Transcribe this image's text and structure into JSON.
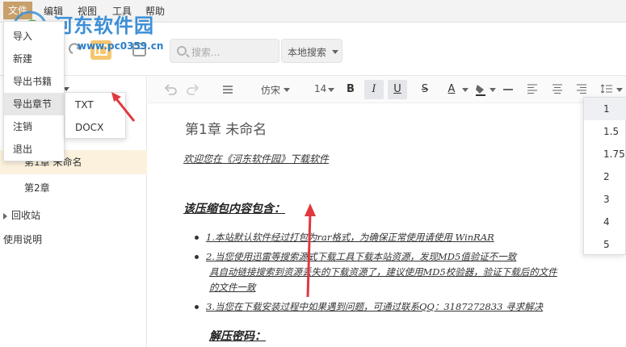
{
  "menubar": {
    "items": [
      {
        "label": "文件"
      },
      {
        "label": "编辑"
      },
      {
        "label": "视图"
      },
      {
        "label": "工具"
      },
      {
        "label": "帮助"
      }
    ]
  },
  "watermark": {
    "title": "河东软件园",
    "url": "www.pc0359.cn"
  },
  "toolbar": {
    "search_placeholder": "搜索...",
    "search_scope": "本地搜索"
  },
  "file_menu": {
    "items": [
      {
        "label": "导入"
      },
      {
        "label": "新建"
      },
      {
        "label": "导出书籍"
      },
      {
        "label": "导出章节"
      },
      {
        "label": "注销"
      },
      {
        "label": "退出"
      }
    ],
    "submenu": [
      {
        "label": "TXT"
      },
      {
        "label": "DOCX"
      }
    ]
  },
  "sidebar": {
    "chapters": [
      {
        "label": "第1章 未命名"
      },
      {
        "label": "第2章"
      }
    ],
    "recycle_bin": "回收站",
    "help": "使用说明"
  },
  "format_toolbar": {
    "font": "仿宋",
    "font_size": "14",
    "bold": "B",
    "italic": "I",
    "underline": "U",
    "strike": "S",
    "font_color": "A"
  },
  "line_spacing": {
    "options": [
      "1",
      "1.5",
      "1.75",
      "2",
      "3",
      "4",
      "5"
    ],
    "selected": "1"
  },
  "document": {
    "title": "第1章 未命名",
    "intro": "欢迎您在《河东软件园》下载软件",
    "heading": "该压缩包内容包含：",
    "list": [
      "1.本站默认软件经过打包为rar格式，为确保正常使用请使用 WinRAR",
      "2.当您使用迅雷等搜索源式下载工具下载本站资源，发现MD5值验证不一致",
      "具自动链接搜索到资源丢失的下载资源了，建议使用MD5校验器，验证下载后的文件",
      "的文件一致",
      "3.当您在下载安装过程中如果遇到问题，可通过联系QQ：3187272833 寻求解决"
    ],
    "subheading": "解压密码："
  },
  "colors": {
    "accent": "#c8a06a",
    "selected_chapter": "#fbf1dd",
    "arrow": "#e0383e",
    "watermark": "#3d8fd6"
  }
}
